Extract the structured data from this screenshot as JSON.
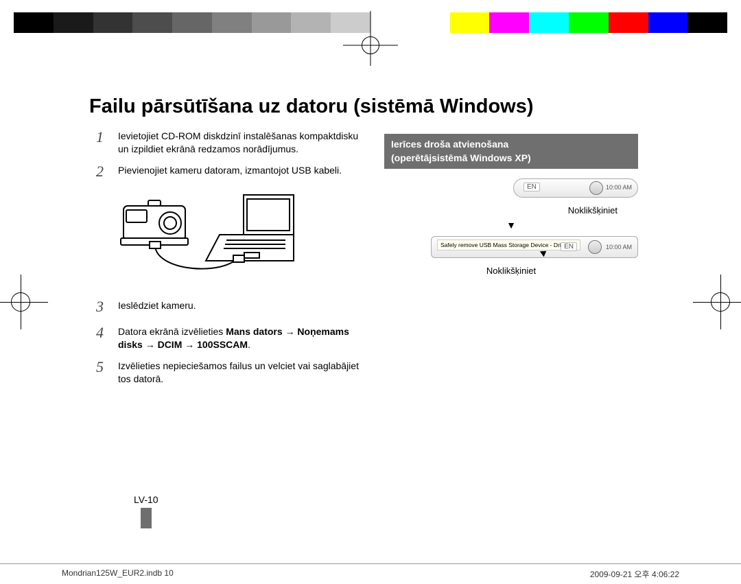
{
  "title": "Failu pārsūtīšana uz datoru (sistēmā Windows)",
  "steps": {
    "s1": "Ievietojiet CD-ROM diskdzinī instalēšanas kompaktdisku un izpildiet ekrānā redzamos norādījumus.",
    "s2": "Pievienojiet kameru datoram, izmantojot USB kabeli.",
    "s3": "Ieslēdziet kameru.",
    "s4_a": "Datora ekrānā izvēlieties ",
    "s4_b": "Mans dators → Noņemams disks → DCIM → 100SSCAM",
    "s4_c": ".",
    "s5": "Izvēlieties nepieciešamos failus un velciet vai saglabājiet tos datorā."
  },
  "right": {
    "heading_line1": "Ierīces droša atvienošana",
    "heading_line2": "(operētājsistēmā Windows XP)",
    "click1": "Noklikšķiniet",
    "click2": "Noklikšķiniet",
    "tray_en": "EN",
    "tray_time": "10:00 AM",
    "balloon": "Safely remove USB Mass Storage Device - Drive(H:)"
  },
  "page_num": "LV-10",
  "prepress": {
    "file": "Mondrian125W_EUR2.indb   10",
    "date": "2009-09-21   오후 4:06:22"
  },
  "numbers": {
    "n1": "1",
    "n2": "2",
    "n3": "3",
    "n4": "4",
    "n5": "5"
  },
  "arrow_down": "▼"
}
